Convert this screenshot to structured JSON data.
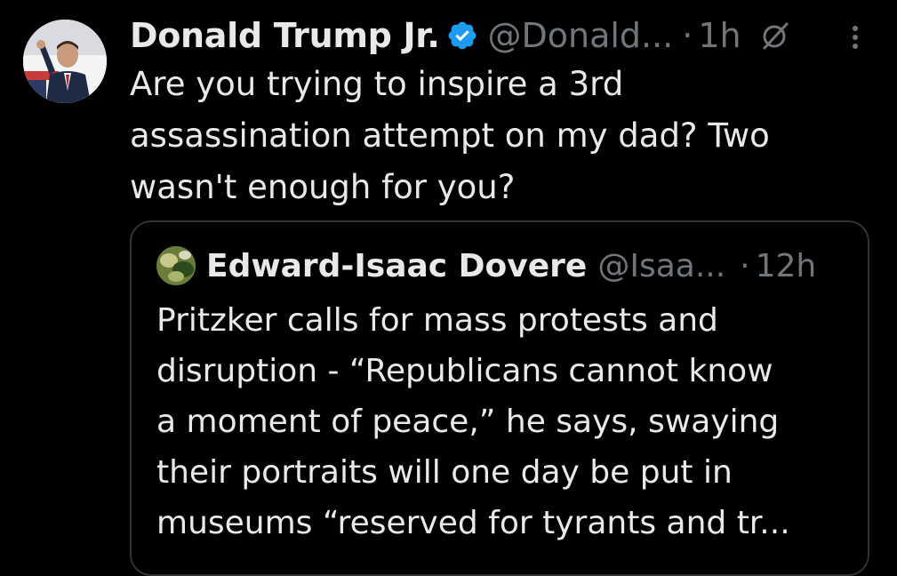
{
  "tweet": {
    "author_name": "Donald Trump Jr.",
    "handle": "@Donald...",
    "separator": "·",
    "time": "1h",
    "text": "Are you trying to inspire a 3rd\nassassination attempt on my dad? Two\nwasn't enough for you?"
  },
  "quoted_tweet": {
    "author_name": "Edward-Isaac Dovere",
    "handle": "@Isaa...",
    "separator": "·",
    "time": "12h",
    "text": "Pritzker calls for mass protests and\ndisruption - “Republicans cannot know\na moment of peace,” he says, swaying\ntheir portraits will one day be put in\nmuseums “reserved for tyrants and tr..."
  },
  "colors": {
    "background": "#000000",
    "primary_text": "#e7e9ea",
    "secondary_text": "#71767b",
    "verified_badge": "#1d9bf0",
    "border": "#2f3336"
  },
  "icons": {
    "verified": "verified-badge-icon",
    "grok": "grok-icon",
    "more": "more-vertical-icon"
  }
}
